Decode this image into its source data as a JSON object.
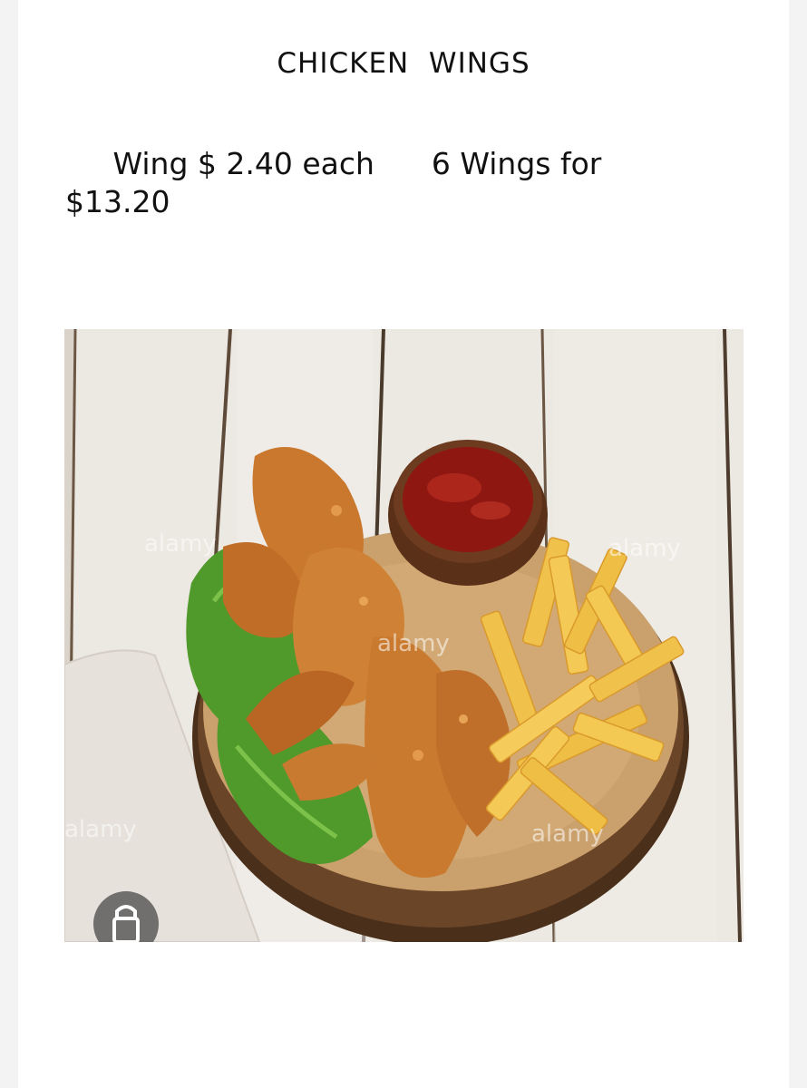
{
  "menu": {
    "title": "CHICKEN  WINGS",
    "price_line": "     Wing $ 2.40 each      6 Wings for $13.20"
  },
  "photo": {
    "watermark": "alamy",
    "colors": {
      "wood": "#e8e3dc",
      "board": "#c8955a",
      "bark": "#5b3b21",
      "lettuce": "#4f9a2a",
      "wing": "#c9782e",
      "fries": "#f1c24b",
      "ketchup": "#8e1712",
      "bowl": "#5a3019"
    }
  }
}
